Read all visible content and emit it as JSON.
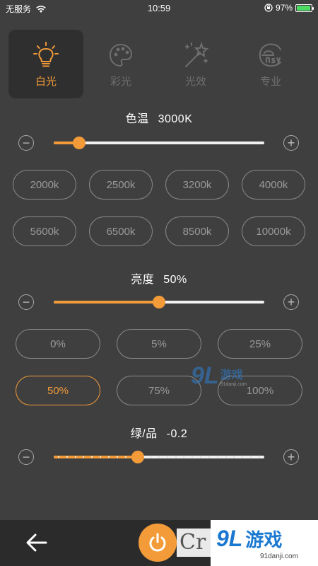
{
  "status_bar": {
    "carrier": "无服务",
    "time": "10:59",
    "battery_percent": "97%",
    "battery_level": 0.97
  },
  "tabs": [
    {
      "label": "白光",
      "icon": "lightbulb-icon",
      "active": true
    },
    {
      "label": "彩光",
      "icon": "palette-icon",
      "active": false
    },
    {
      "label": "光效",
      "icon": "magic-wand-icon",
      "active": false
    },
    {
      "label": "专业",
      "icon": "ensy-logo-icon",
      "active": false
    }
  ],
  "color_temp": {
    "label": "色温",
    "value_text": "3000K",
    "slider_value": 0.12,
    "presets": [
      "2000k",
      "2500k",
      "3200k",
      "4000k",
      "5600k",
      "6500k",
      "8500k",
      "10000k"
    ]
  },
  "brightness": {
    "label": "亮度",
    "value_text": "50%",
    "slider_value": 0.5,
    "presets": [
      "0%",
      "5%",
      "25%",
      "50%",
      "75%",
      "100%"
    ],
    "selected_preset": "50%"
  },
  "green_magenta": {
    "label": "绿/品",
    "value_text": "-0.2",
    "slider_value": 0.4
  },
  "watermark": {
    "mid_logo": "9L",
    "mid_text": "游戏",
    "mid_url": "91danji.com",
    "brand_logo": "9L",
    "brand_text": "游戏",
    "brand_url": "91danji.com",
    "cr_text": "Cr"
  },
  "colors": {
    "accent": "#f29b38",
    "background": "#3f3f3f",
    "bottom_bar": "#2b2b2b"
  }
}
